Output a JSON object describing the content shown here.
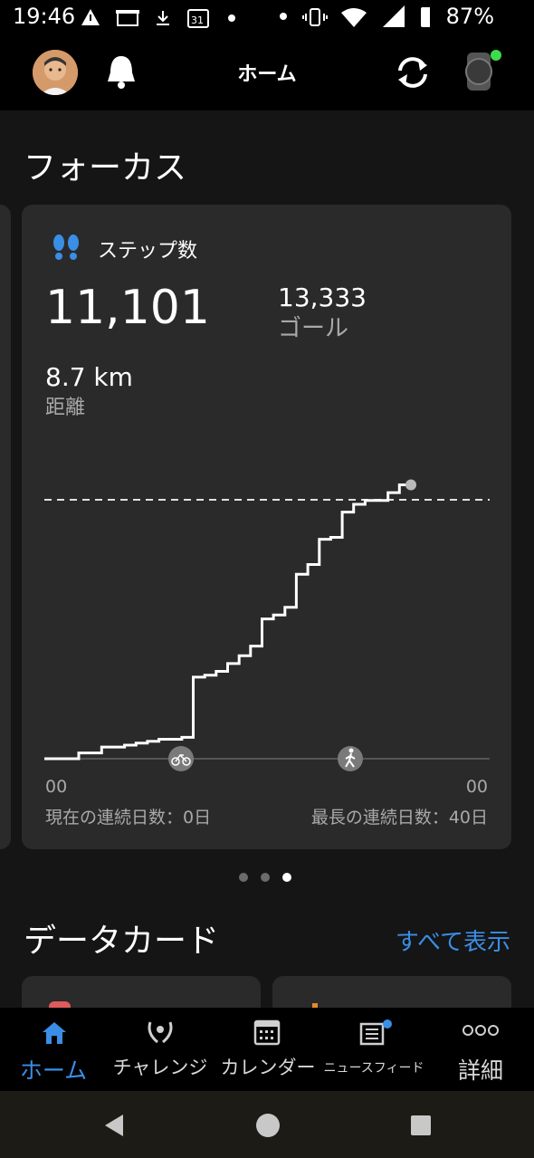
{
  "status_bar": {
    "time": "19:46",
    "battery": "87%"
  },
  "top_bar": {
    "title": "ホーム"
  },
  "focus": {
    "section_title": "フォーカス",
    "card": {
      "label": "ステップ数",
      "steps_value": "11,101",
      "goal_value": "13,333",
      "goal_label": "ゴール",
      "distance_value": "8.7 km",
      "distance_label": "距離",
      "x_start_label": "00",
      "x_end_label": "00",
      "current_streak": "現在の連続日数：0日",
      "longest_streak": "最長の連続日数：40日"
    },
    "chart_data": {
      "type": "line",
      "series": [
        {
          "values": [
            0,
            0,
            0,
            300,
            300,
            600,
            600,
            700,
            800,
            900,
            1000,
            1000,
            1100,
            4200,
            4300,
            4500,
            4900,
            5300,
            5800,
            7200,
            7400,
            7800,
            9500,
            10000,
            11300,
            11400,
            12700,
            13100,
            13300,
            13300,
            13700,
            14100,
            14100
          ]
        }
      ],
      "goal": 13333,
      "goal_line": "dashed"
    },
    "pager": {
      "count": 3,
      "active": 2
    }
  },
  "data_cards": {
    "section_title": "データカード",
    "show_all": "すべて表示"
  },
  "bottom_nav": {
    "items": [
      {
        "label": "ホーム",
        "icon": "home-icon",
        "active": true
      },
      {
        "label": "チャレンジ",
        "icon": "laurel-icon",
        "active": false
      },
      {
        "label": "カレンダー",
        "icon": "calendar-icon",
        "active": false
      },
      {
        "label": "ニュースフィード",
        "icon": "newsfeed-icon",
        "active": false
      },
      {
        "label": "詳細",
        "icon": "more-icon",
        "active": false
      }
    ]
  },
  "colors": {
    "accent": "#3a8ee6",
    "card_bg": "#2a2a2a",
    "page_bg": "#151515",
    "watch_status": "#3ddc4a"
  }
}
